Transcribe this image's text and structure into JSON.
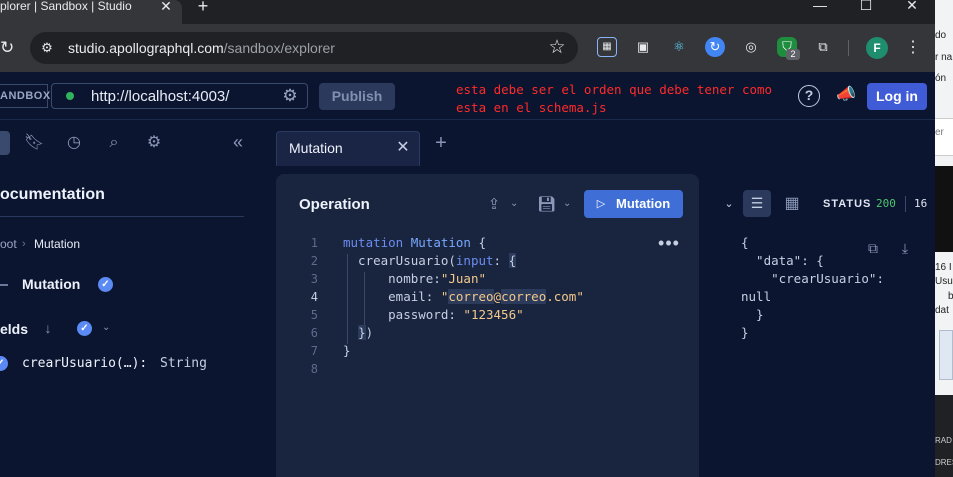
{
  "browser": {
    "tab_title": "plorer | Sandbox | Studio",
    "tab_close": "✕",
    "new_tab": "+",
    "window_controls": [
      "—",
      "☐",
      "✕"
    ],
    "url_host": "studio.apollographql.com",
    "url_path": "/sandbox/explorer",
    "profile_initial": "F",
    "extension_badge": "2",
    "icons": [
      "reload-icon",
      "site-info-icon",
      "bookmark-star-icon",
      "extension-icons",
      "profile-avatar",
      "menu-kebab-icon"
    ]
  },
  "side_strip": {
    "texts": [
      "do",
      "r na",
      "ón",
      "er",
      "16 I",
      "Usu",
      "b",
      "dat",
      "RAD",
      "DRES ."
    ]
  },
  "header": {
    "sandbox_label": "ANDBOX",
    "endpoint": "http://localhost:4003/",
    "endpoint_status_color": "#2fb35c",
    "publish_label": "Publish",
    "annotation": "esta debe ser el orden que debe tener como esta en el schema.js",
    "login_label": "Log in",
    "accent_color": "#3f5bd6"
  },
  "sidebar": {
    "doc_title": "ocumentation",
    "breadcrumb_root": "oot",
    "breadcrumb_sep": "›",
    "breadcrumb_current": "Mutation",
    "type_name": "Mutation",
    "fields_label": "elds",
    "field_name": "crearUsuario(…):",
    "field_type": "String",
    "check_glyph": "✓"
  },
  "editor": {
    "tab_label": "Mutation",
    "panel_title": "Operation",
    "run_label": "Mutation",
    "more_glyph": "•••",
    "line_numbers": [
      "1",
      "2",
      "3",
      "4",
      "5",
      "6",
      "7",
      "8"
    ]
  },
  "response": {
    "status_label": "STATUS",
    "status_code": "200",
    "status_time": "16",
    "lines": [
      "{",
      "  \"data\": {",
      "    \"crearUsuario\":",
      "null",
      "  }",
      "}"
    ]
  }
}
